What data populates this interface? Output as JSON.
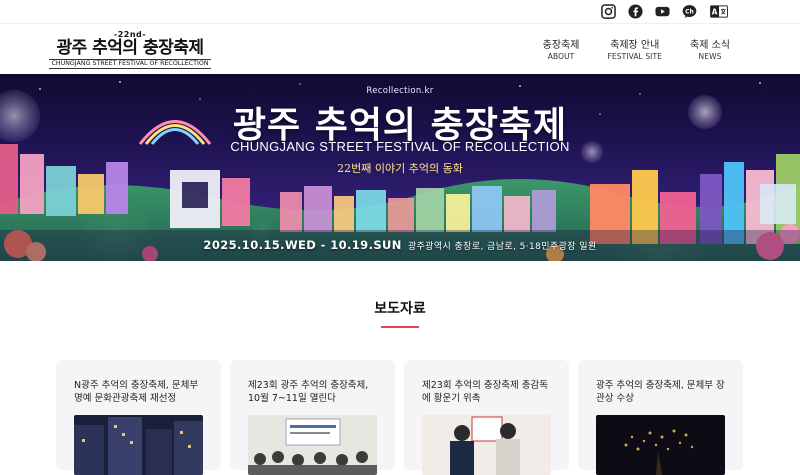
{
  "social": [
    {
      "name": "instagram-icon"
    },
    {
      "name": "facebook-icon"
    },
    {
      "name": "youtube-icon"
    },
    {
      "name": "kakao-channel-icon"
    },
    {
      "name": "language-icon"
    }
  ],
  "social_labels": {
    "kakao": "Ch",
    "language_a": "A"
  },
  "logo": {
    "edition": "-22nd-",
    "title": "광주 추억의 충장축제",
    "subtitle": "CHUNGJANG STREET FESTIVAL OF RECOLLECTION"
  },
  "nav": [
    {
      "ko": "충장축제",
      "en": "ABOUT"
    },
    {
      "ko": "축제장 안내",
      "en": "FESTIVAL SITE"
    },
    {
      "ko": "축제 소식",
      "en": "NEWS"
    }
  ],
  "banner": {
    "site": "Recollection.kr",
    "title": "광주 추억의 충장축제",
    "english": "CHUNGJANG STREET FESTIVAL OF RECOLLECTION",
    "tagline": "22번째 이야기 추억의 동화",
    "dates": "2025.10.15.WED - 10.19.SUN",
    "location": "광주광역시 충장로, 금남로, 5·18민주광장 일원"
  },
  "section": {
    "title": "보도자료"
  },
  "cards": [
    {
      "title": "N광주 추억의 충장축제, 문체부 명예 문화관광축제 재선정"
    },
    {
      "title": "제23회 광주 추억의 충장축제, 10월 7~11일 열린다"
    },
    {
      "title": "제23회 추억의 충장축제 총감독에 황운기 위촉"
    },
    {
      "title": "광주 추억의 충장축제, 문체부 장관상 수상"
    }
  ],
  "colors": {
    "accent": "#e34a4a",
    "card_bg": "#f5f5f7",
    "banner_night": "#1e1250"
  }
}
